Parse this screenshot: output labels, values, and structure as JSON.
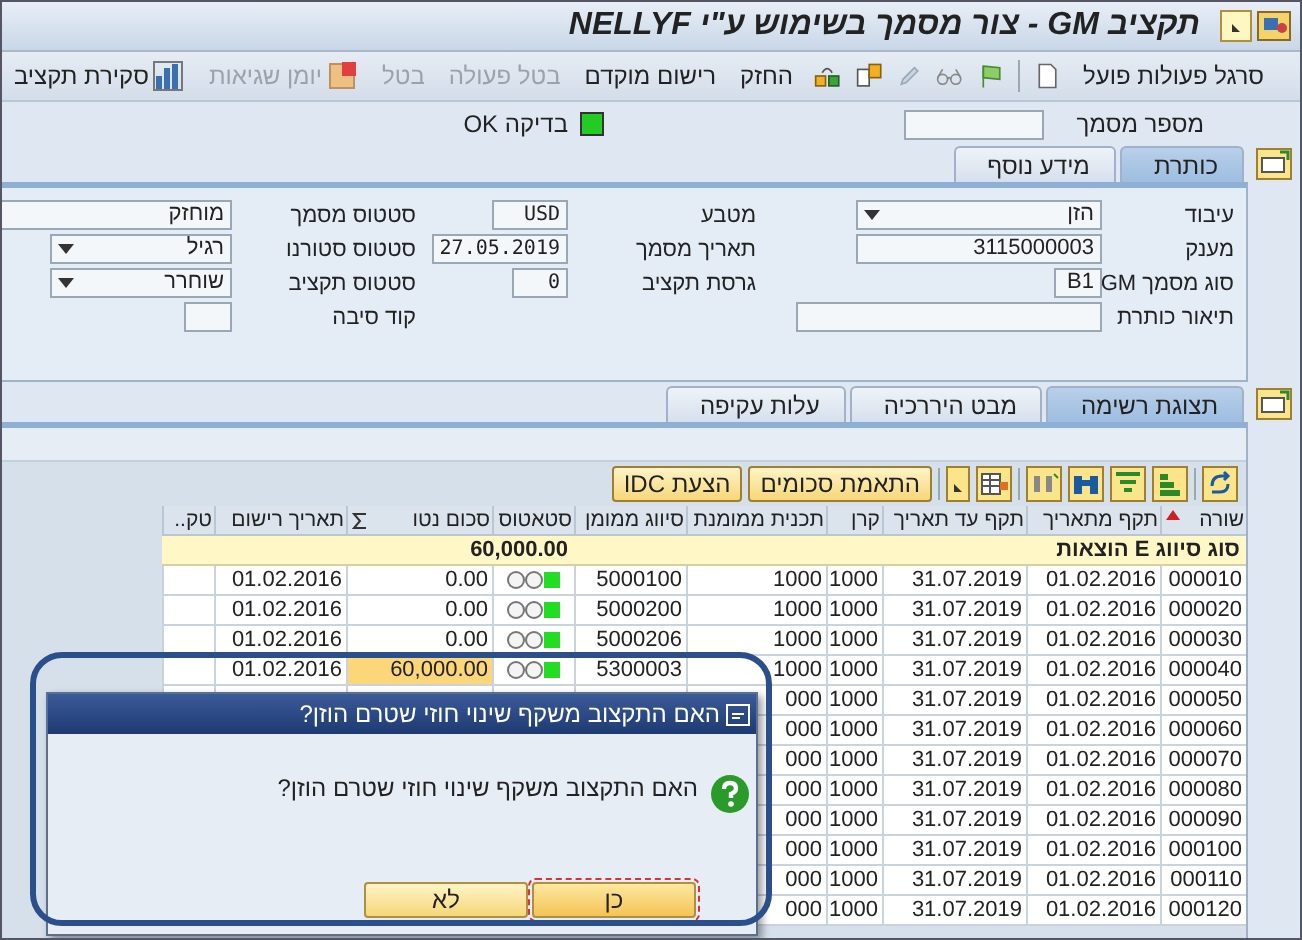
{
  "window": {
    "title": "תקציב GM - צור מסמך בשימוש ע\"י NELLYF"
  },
  "toolbar": {
    "menu_label": "סרגל פעולות פועל",
    "buttons": [
      {
        "label": "החזק",
        "disabled": false,
        "kind": "text"
      },
      {
        "label": "רישום מוקדם",
        "disabled": false,
        "kind": "text"
      },
      {
        "label": "בטל פעולה",
        "disabled": true,
        "kind": "text"
      },
      {
        "label": "בטל",
        "disabled": true,
        "kind": "text"
      },
      {
        "label": "יומן שגיאות",
        "disabled": true,
        "kind": "icon_text"
      },
      {
        "label": "סקירת תקציב",
        "disabled": false,
        "kind": "icon_text"
      }
    ]
  },
  "document_number": {
    "label": "מספר מסמך"
  },
  "check": {
    "label": "בדיקה OK",
    "color": "#22cc22"
  },
  "header_tabs": [
    {
      "label": "כותרת",
      "selected": true
    },
    {
      "label": "מידע נוסף",
      "selected": false
    }
  ],
  "header_fields": [
    [
      {
        "label": "עיבוד",
        "value": "הזן",
        "kind": "dropdown"
      },
      {
        "label": "מענק",
        "value": "3115000003",
        "kind": "text"
      },
      {
        "label": "סוג מסמך GM",
        "value": "B1",
        "kind": "text"
      },
      {
        "label": "תיאור כותרת",
        "kind": "text"
      }
    ],
    [
      {
        "label": "מטבע",
        "value": "USD",
        "kind": "text"
      },
      {
        "label": "תאריך מסמך",
        "value": "27.05.2019",
        "kind": "text"
      },
      {
        "label": "גרסת תקציב",
        "value": "0",
        "kind": "text"
      }
    ],
    [
      {
        "label": "סטטוס מסמך",
        "value": "מוחזק",
        "kind": "text"
      },
      {
        "label": "סטטוס סטורנו",
        "value": "רגיל",
        "kind": "dropdown"
      },
      {
        "label": "סטטוס תקציב",
        "value": "שוחרר",
        "kind": "dropdown"
      },
      {
        "label": "קוד סיבה",
        "kind": "text"
      }
    ]
  ],
  "list_tabs": [
    {
      "label": "תצוגת רשימה",
      "selected": true
    },
    {
      "label": "מבט היררכיה",
      "selected": false
    },
    {
      "label": "עלות עקיפה",
      "selected": false
    }
  ],
  "table_buttons": [
    "התאמת סכומים",
    "הצעת IDC"
  ],
  "table": {
    "columns": [
      {
        "label": "שורה",
        "sorted": true,
        "totaled": false
      },
      {
        "label": "תקף מתאריך",
        "sorted": false,
        "totaled": false
      },
      {
        "label": "תקף עד תאריך",
        "sorted": false,
        "totaled": false
      },
      {
        "label": "קרן",
        "sorted": false,
        "totaled": false
      },
      {
        "label": "תכנית ממומנת",
        "sorted": false,
        "totaled": false
      },
      {
        "label": "סיווג ממומן",
        "sorted": false,
        "totaled": false
      },
      {
        "label": "סטאטוס",
        "sorted": false,
        "totaled": false
      },
      {
        "label": "סכום נטו",
        "sorted": false,
        "totaled": true
      },
      {
        "label": "תאריך רישום",
        "sorted": false,
        "totaled": false
      },
      {
        "label": "טק..",
        "sorted": false,
        "totaled": false
      }
    ],
    "group": {
      "label": "סוג סיווג E הוצאות",
      "total": "60,000.00"
    },
    "rows": [
      {
        "line": "000010",
        "valid_from": "01.02.2016",
        "valid_to": "31.07.2019",
        "fund": "1000",
        "plan": "1000",
        "classification": "5000100",
        "status": {
          "color": "#22dd22"
        },
        "net": "0.00",
        "posting_date": "01.02.2016",
        "highlighted": false
      },
      {
        "line": "000020",
        "valid_from": "01.02.2016",
        "valid_to": "31.07.2019",
        "fund": "1000",
        "plan": "1000",
        "classification": "5000200",
        "status": {
          "color": "#22dd22"
        },
        "net": "0.00",
        "posting_date": "01.02.2016",
        "highlighted": false
      },
      {
        "line": "000030",
        "valid_from": "01.02.2016",
        "valid_to": "31.07.2019",
        "fund": "1000",
        "plan": "1000",
        "classification": "5000206",
        "status": {
          "color": "#22dd22"
        },
        "net": "0.00",
        "posting_date": "01.02.2016",
        "highlighted": false
      },
      {
        "line": "000040",
        "valid_from": "01.02.2016",
        "valid_to": "31.07.2019",
        "fund": "1000",
        "plan": "1000",
        "classification": "5300003",
        "status": {
          "color": "#22dd22"
        },
        "net": "60,000.00",
        "posting_date": "01.02.2016",
        "highlighted": true
      },
      {
        "line": "000050",
        "valid_from": "01.02.2016",
        "valid_to": "31.07.2019",
        "fund": "1000",
        "plan": "000"
      },
      {
        "line": "000060",
        "valid_from": "01.02.2016",
        "valid_to": "31.07.2019",
        "fund": "1000",
        "plan": "000"
      },
      {
        "line": "000070",
        "valid_from": "01.02.2016",
        "valid_to": "31.07.2019",
        "fund": "1000",
        "plan": "000"
      },
      {
        "line": "000080",
        "valid_from": "01.02.2016",
        "valid_to": "31.07.2019",
        "fund": "1000",
        "plan": "000"
      },
      {
        "line": "000090",
        "valid_from": "01.02.2016",
        "valid_to": "31.07.2019",
        "fund": "1000",
        "plan": "000"
      },
      {
        "line": "000100",
        "valid_from": "01.02.2016",
        "valid_to": "31.07.2019",
        "fund": "1000",
        "plan": "000"
      },
      {
        "line": "000110",
        "valid_from": "01.02.2016",
        "valid_to": "31.07.2019",
        "fund": "1000",
        "plan": "000"
      },
      {
        "line": "000120",
        "valid_from": "01.02.2016",
        "valid_to": "31.07.2019",
        "fund": "1000",
        "plan": "000"
      }
    ]
  },
  "dialog": {
    "title": "האם התקצוב משקף שינוי חוזי שטרם הוזן?",
    "message": "האם התקצוב משקף שינוי חוזי שטרם הוזן?",
    "buttons": [
      {
        "label": "כן",
        "focused": true
      },
      {
        "label": "לא",
        "focused": false
      }
    ]
  }
}
